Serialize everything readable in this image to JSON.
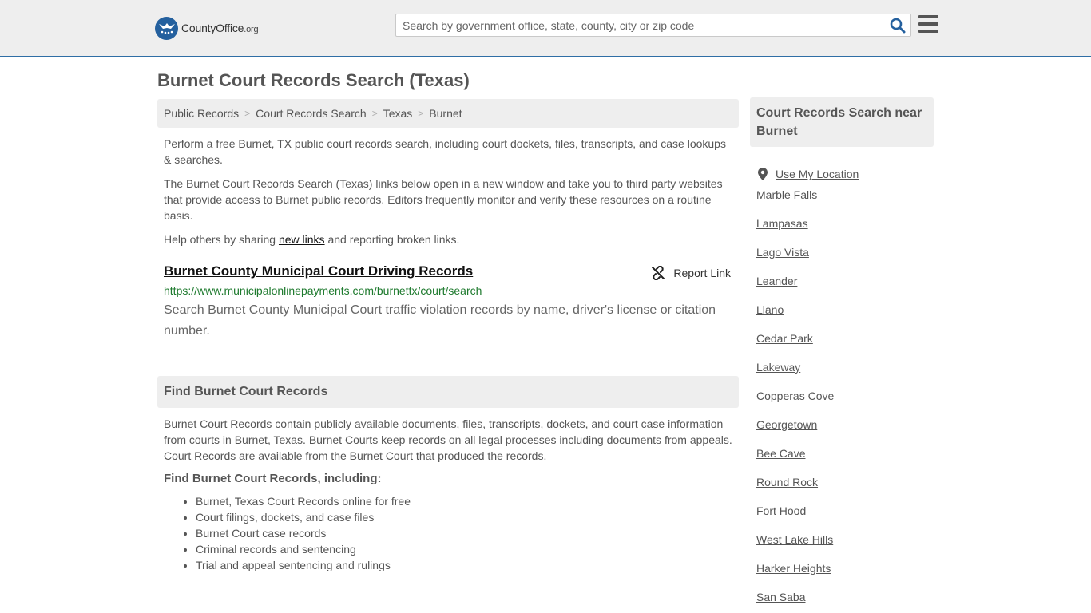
{
  "header": {
    "logo_main": "CountyOffice",
    "logo_suffix": ".org",
    "search_placeholder": "Search by government office, state, county, city or zip code"
  },
  "page_title": "Burnet Court Records Search (Texas)",
  "breadcrumb": [
    "Public Records",
    "Court Records Search",
    "Texas",
    "Burnet"
  ],
  "intro": {
    "p1": "Perform a free Burnet, TX public court records search, including court dockets, files, transcripts, and case lookups & searches.",
    "p2": "The Burnet Court Records Search (Texas) links below open in a new window and take you to third party websites that provide access to Burnet public records. Editors frequently monitor and verify these resources on a routine basis.",
    "p3_before": "Help others by sharing ",
    "p3_link": "new links",
    "p3_after": " and reporting broken links."
  },
  "record": {
    "title": "Burnet County Municipal Court Driving Records",
    "report_label": "Report Link",
    "url": "https://www.municipalonlinepayments.com/burnettx/court/search",
    "description": "Search Burnet County Municipal Court traffic violation records by name, driver's license or citation number."
  },
  "find_section": {
    "heading": "Find Burnet Court Records",
    "text": "Burnet Court Records contain publicly available documents, files, transcripts, dockets, and court case information from courts in Burnet, Texas. Burnet Courts keep records on all legal processes including documents from appeals. Court Records are available from the Burnet Court that produced the records.",
    "subheading": "Find Burnet Court Records, including:",
    "bullets": [
      "Burnet, Texas Court Records online for free",
      "Court filings, dockets, and case files",
      "Burnet Court case records",
      "Criminal records and sentencing",
      "Trial and appeal sentencing and rulings"
    ]
  },
  "sidebar": {
    "heading": "Court Records Search near Burnet",
    "use_location": "Use My Location",
    "cities": [
      "Marble Falls",
      "Lampasas",
      "Lago Vista",
      "Leander",
      "Llano",
      "Cedar Park",
      "Lakeway",
      "Copperas Cove",
      "Georgetown",
      "Bee Cave",
      "Round Rock",
      "Fort Hood",
      "West Lake Hills",
      "Harker Heights",
      "San Saba"
    ]
  },
  "colors": {
    "brand_blue": "#24609e",
    "url_green": "#1e7a2e",
    "panel_gray": "#eeeeee"
  }
}
